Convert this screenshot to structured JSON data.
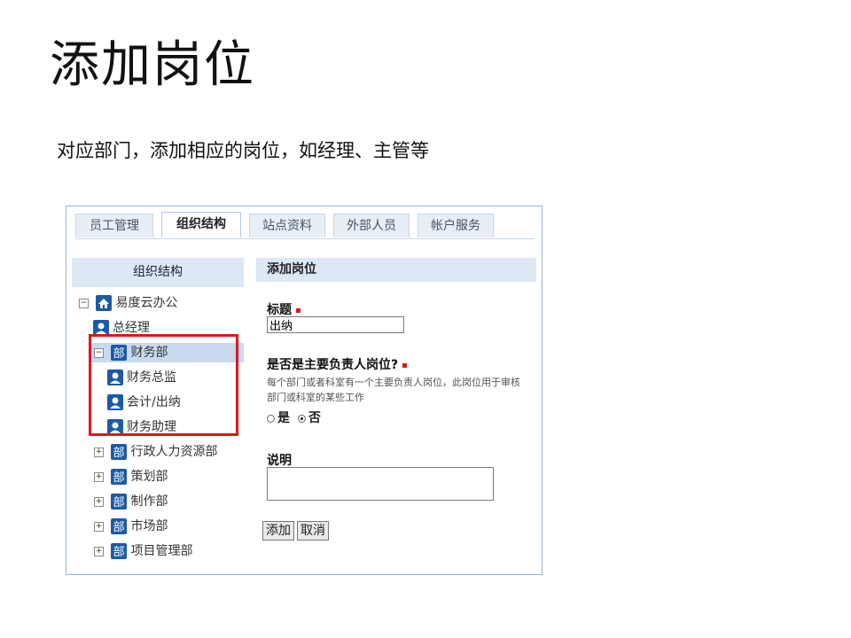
{
  "slide": {
    "title": "添加岗位",
    "subtitle": "对应部门，添加相应的岗位，如经理、主管等"
  },
  "tabs": [
    "员工管理",
    "组织结构",
    "站点资料",
    "外部人员",
    "帐户服务"
  ],
  "active_tab": "组织结构",
  "tree": {
    "header": "组织结构",
    "root": "易度云办公",
    "nodes": [
      {
        "label": "总经理",
        "type": "position"
      },
      {
        "label": "财务部",
        "type": "department",
        "expanded": true
      },
      {
        "label": "财务总监",
        "type": "position"
      },
      {
        "label": "会计/出纳",
        "type": "position"
      },
      {
        "label": "财务助理",
        "type": "position"
      },
      {
        "label": "行政人力资源部",
        "type": "department"
      },
      {
        "label": "策划部",
        "type": "department"
      },
      {
        "label": "制作部",
        "type": "department"
      },
      {
        "label": "市场部",
        "type": "department"
      },
      {
        "label": "项目管理部",
        "type": "department"
      }
    ],
    "dept_icon_char": "部"
  },
  "form": {
    "header": "添加岗位",
    "title_label": "标题",
    "title_value": "出纳",
    "primary_label": "是否是主要负责人岗位?",
    "primary_hint": "每个部门或者科室有一个主要负责人岗位，此岗位用于审核部门或科室的某些工作",
    "yes_label": "是",
    "no_label": "否",
    "selected_option": "否",
    "desc_label": "说明",
    "desc_value": "",
    "add_button": "添加",
    "cancel_button": "取消"
  },
  "colors": {
    "accent": "#dde8f5",
    "highlight": "#e0161b",
    "icon_blue": "#1b5aa8"
  }
}
